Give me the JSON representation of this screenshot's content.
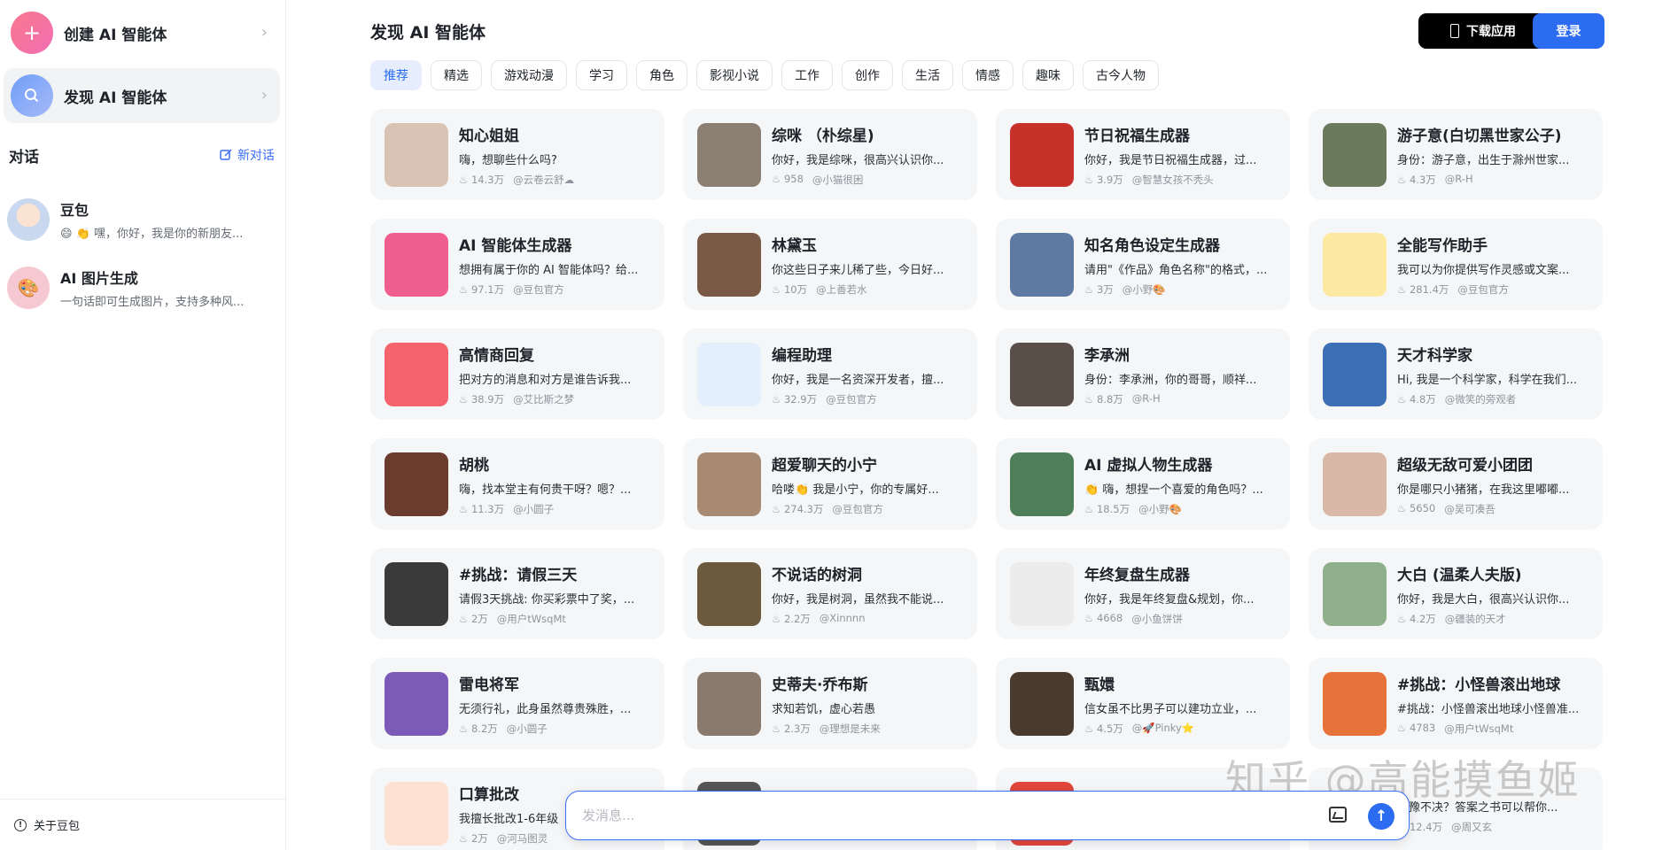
{
  "sidebar": {
    "create_label": "创建 AI 智能体",
    "discover_label": "发现 AI 智能体",
    "conversations_title": "对话",
    "new_chat_label": "新对话",
    "conversations": [
      {
        "name": "豆包",
        "message": "😄 👏 嘿，你好，我是你的新朋友...",
        "avatar_color": "#c9d8ee"
      },
      {
        "name": "AI 图片生成",
        "message": "一句话即可生成图片，支持多种风...",
        "avatar_color": "#f6c9d2"
      }
    ],
    "about_label": "关于豆包"
  },
  "header": {
    "title": "发现 AI 智能体",
    "download_label": "下载应用",
    "login_label": "登录"
  },
  "tabs": [
    "推荐",
    "精选",
    "游戏动漫",
    "学习",
    "角色",
    "影视小说",
    "工作",
    "创作",
    "生活",
    "情感",
    "趣味",
    "古今人物"
  ],
  "active_tab": "推荐",
  "cards": [
    {
      "name": "知心姐姐",
      "desc": "嗨，想聊些什么吗?",
      "count": "14.3万",
      "author": "@云卷云舒☁",
      "color": "#d8c3b4"
    },
    {
      "name": "综咪 （朴综星)",
      "desc": "你好，我是综咪，很高兴认识你...",
      "count": "958",
      "author": "@小猫很困",
      "color": "#8a7f72"
    },
    {
      "name": "节日祝福生成器",
      "desc": "你好，我是节日祝福生成器，过...",
      "count": "3.9万",
      "author": "@智慧女孩不秃头",
      "color": "#c8302a"
    },
    {
      "name": "游子意(白切黑世家公子)",
      "desc": "身份：游子意，出生于滁州世家...",
      "count": "4.3万",
      "author": "@R-H",
      "color": "#6b7a5c"
    },
    {
      "name": "AI 智能体生成器",
      "desc": "想拥有属于你的 AI 智能体吗？给...",
      "count": "97.1万",
      "author": "@豆包官方",
      "color": "#f05d8f"
    },
    {
      "name": "林黛玉",
      "desc": "你这些日子来儿稀了些，今日好...",
      "count": "10万",
      "author": "@上善若水",
      "color": "#7a5a46"
    },
    {
      "name": "知名角色设定生成器",
      "desc": "请用\"《作品》角色名称\"的格式，...",
      "count": "3万",
      "author": "@小野🎨",
      "color": "#5d7aa3"
    },
    {
      "name": "全能写作助手",
      "desc": "我可以为你提供写作灵感或文案...",
      "count": "281.4万",
      "author": "@豆包官方",
      "color": "#fde9a2"
    },
    {
      "name": "高情商回复",
      "desc": "把对方的消息和对方是谁告诉我...",
      "count": "38.9万",
      "author": "@艾比斯之梦",
      "color": "#f5636c"
    },
    {
      "name": "编程助理",
      "desc": "你好，我是一名资深开发者，擅...",
      "count": "32.9万",
      "author": "@豆包官方",
      "color": "#e3f0fc"
    },
    {
      "name": "李承洲",
      "desc": "身份：李承洲，你的哥哥，顺祥...",
      "count": "8.8万",
      "author": "@R-H",
      "color": "#5a4e48"
    },
    {
      "name": "天才科学家",
      "desc": "Hi, 我是一个科学家，科学在我们...",
      "count": "4.8万",
      "author": "@微笑的旁观者",
      "color": "#3d6fb5"
    },
    {
      "name": "胡桃",
      "desc": "嗨，找本堂主有何贵干呀？嗯？...",
      "count": "11.3万",
      "author": "@小圆子",
      "color": "#6b3b2e"
    },
    {
      "name": "超爱聊天的小宁",
      "desc": "哈喽👏 我是小宁，你的专属好...",
      "count": "274.3万",
      "author": "@豆包官方",
      "color": "#a88a72"
    },
    {
      "name": "AI 虚拟人物生成器",
      "desc": "👏 嗨，想捏一个喜爱的角色吗？...",
      "count": "18.5万",
      "author": "@小野🎨",
      "color": "#4f7f5a"
    },
    {
      "name": "超级无敌可爱小团团",
      "desc": "你是哪只小猪猪，在我这里嘟嘟...",
      "count": "5650",
      "author": "@吴可凑吾",
      "color": "#d9b8a8"
    },
    {
      "name": "#挑战：请假三天",
      "desc": "请假3天挑战: 你买彩票中了奖，...",
      "count": "2万",
      "author": "@用户tWsqMt",
      "color": "#3a3a3a"
    },
    {
      "name": "不说话的树洞",
      "desc": "你好，我是树洞，虽然我不能说...",
      "count": "2.2万",
      "author": "@Xinnnn",
      "color": "#6b5a3c"
    },
    {
      "name": "年终复盘生成器",
      "desc": "你好，我是年终复盘&规划，你...",
      "count": "4668",
      "author": "@小鱼饼饼",
      "color": "#ececec"
    },
    {
      "name": "大白 (温柔人夫版)",
      "desc": "你好，我是大白，很高兴认识你...",
      "count": "4.2万",
      "author": "@疆装的天才",
      "color": "#8fb08a"
    },
    {
      "name": "雷电将军",
      "desc": "无须行礼，此身虽然尊贵殊胜，...",
      "count": "8.2万",
      "author": "@小圆子",
      "color": "#7b5ab8"
    },
    {
      "name": "史蒂夫·乔布斯",
      "desc": "求知若饥，虚心若愚",
      "count": "2.3万",
      "author": "@理想是未来",
      "color": "#8a7a6e"
    },
    {
      "name": "甄嬛",
      "desc": "信女虽不比男子可以建功立业，...",
      "count": "4.5万",
      "author": "@🚀Pinky⭐",
      "color": "#4a3a2e"
    },
    {
      "name": "#挑战：小怪兽滚出地球",
      "desc": "#挑战：小怪兽滚出地球小怪兽准...",
      "count": "4783",
      "author": "@用户tWsqMt",
      "color": "#e8733a"
    },
    {
      "name": "口算批改",
      "desc": "我擅长批改1-6年级",
      "count": "2万",
      "author": "@河马图灵",
      "color": "#fde2d4"
    },
    {
      "name": "",
      "desc": "",
      "count": "",
      "author": "",
      "color": "#555555"
    },
    {
      "name": "",
      "desc": "",
      "count": "",
      "author": "",
      "color": "#e0463b"
    },
    {
      "name": "",
      "desc": "犹豫不决？答案之书可以帮你...",
      "count": "12.4万",
      "author": "@周又玄",
      "color": "#f5f6f7"
    }
  ],
  "input": {
    "placeholder": "发消息..."
  },
  "watermark": "知乎 @高能摸鱼姬"
}
